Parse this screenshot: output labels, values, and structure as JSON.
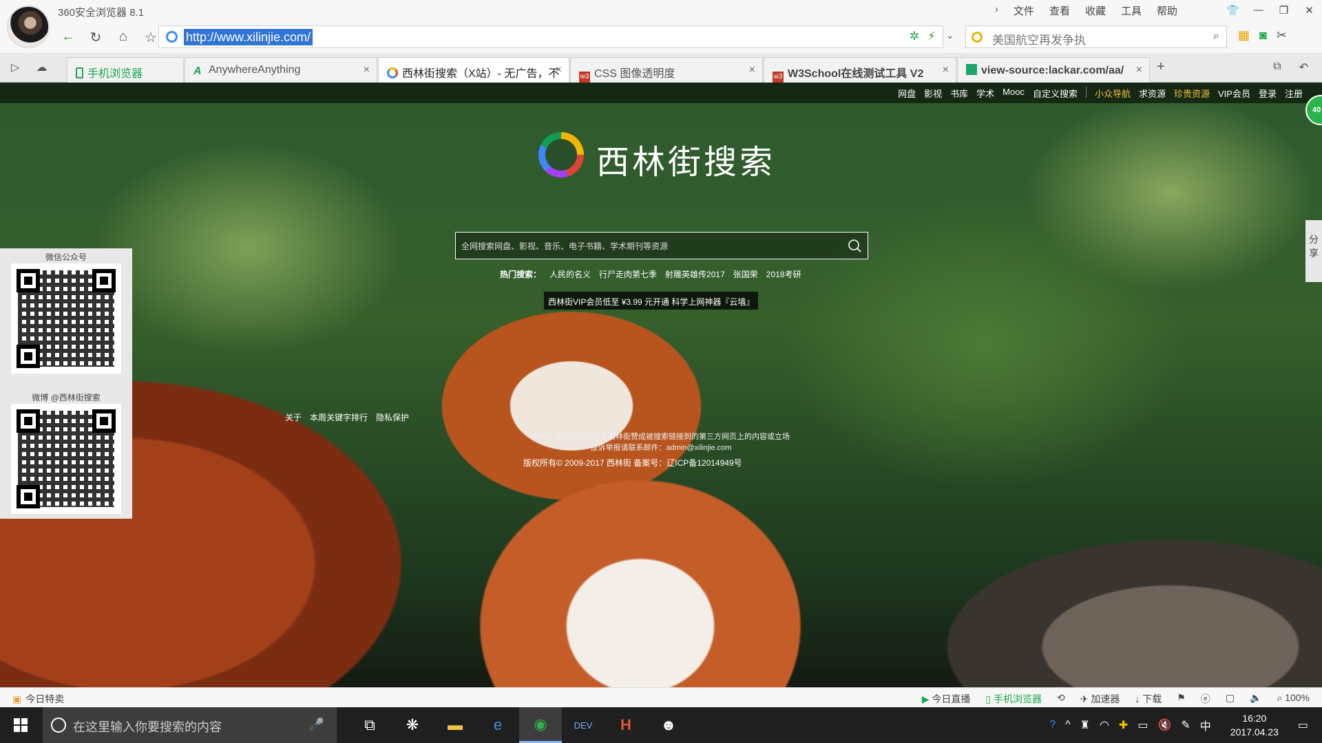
{
  "app_title": "360安全浏览器 8.1",
  "menu": [
    "文件",
    "查看",
    "收藏",
    "工具",
    "帮助"
  ],
  "address": {
    "url": "http://www.xilinjie.com/"
  },
  "search_bar": {
    "placeholder": "美国航空再发争执"
  },
  "tabs": [
    {
      "label": "手机浏览器",
      "icon": "phone-icon"
    },
    {
      "label": "AnywhereAnything",
      "icon": "aa-icon"
    },
    {
      "label": "西林街搜索（X站）- 无广告，不",
      "icon": "xilinjie-icon",
      "active": true
    },
    {
      "label": "CSS 图像透明度",
      "icon": "w3-icon"
    },
    {
      "label": "W3School在线测试工具 V2",
      "icon": "w3-icon"
    },
    {
      "label": "view-source:lackar.com/aa/",
      "icon": "page-icon"
    }
  ],
  "page": {
    "topnav": [
      "网盘",
      "影视",
      "书库",
      "学术",
      "Mooc",
      "自定义搜索",
      "小众导航",
      "求资源",
      "珍贵资源",
      "VIP会员",
      "登录",
      "注册"
    ],
    "badge": "40",
    "logo_text": "西林街搜索",
    "search_placeholder": "全网搜索网盘、影视、音乐、电子书籍、学术期刊等资源",
    "hot_label": "热门搜索：",
    "hot": [
      "人民的名义",
      "行尸走肉第七季",
      "射雕英雄传2017",
      "张国荣",
      "2018考研"
    ],
    "promo": "西林街VIP会员低至 ¥3.99 元开通   科学上网神器『云墙』",
    "qr_wechat_label": "微信公众号",
    "qr_weibo_label": "微博 @西林街搜索",
    "footer_links": [
      "关于",
      "本周关键字排行",
      "隐私保护"
    ],
    "notice_1": "声明：搜索结果不代表西林街赞成被搜索链接到的第三方网页上的内容或立场",
    "notice_2": "投诉举报请联系邮件：admin@xilinjie.com",
    "copyright": "版权所有© 2009-2017  西林街  备案号：辽ICP备12014949号",
    "share": "分享"
  },
  "statusbar": {
    "left": "今日特卖",
    "right": [
      "今日直播",
      "手机浏览器",
      "加速器",
      "下载",
      "100%"
    ]
  },
  "taskbar": {
    "search_placeholder": "在这里输入你要搜索的内容",
    "time": "16:20",
    "date": "2017.04.23",
    "ime": "中"
  }
}
